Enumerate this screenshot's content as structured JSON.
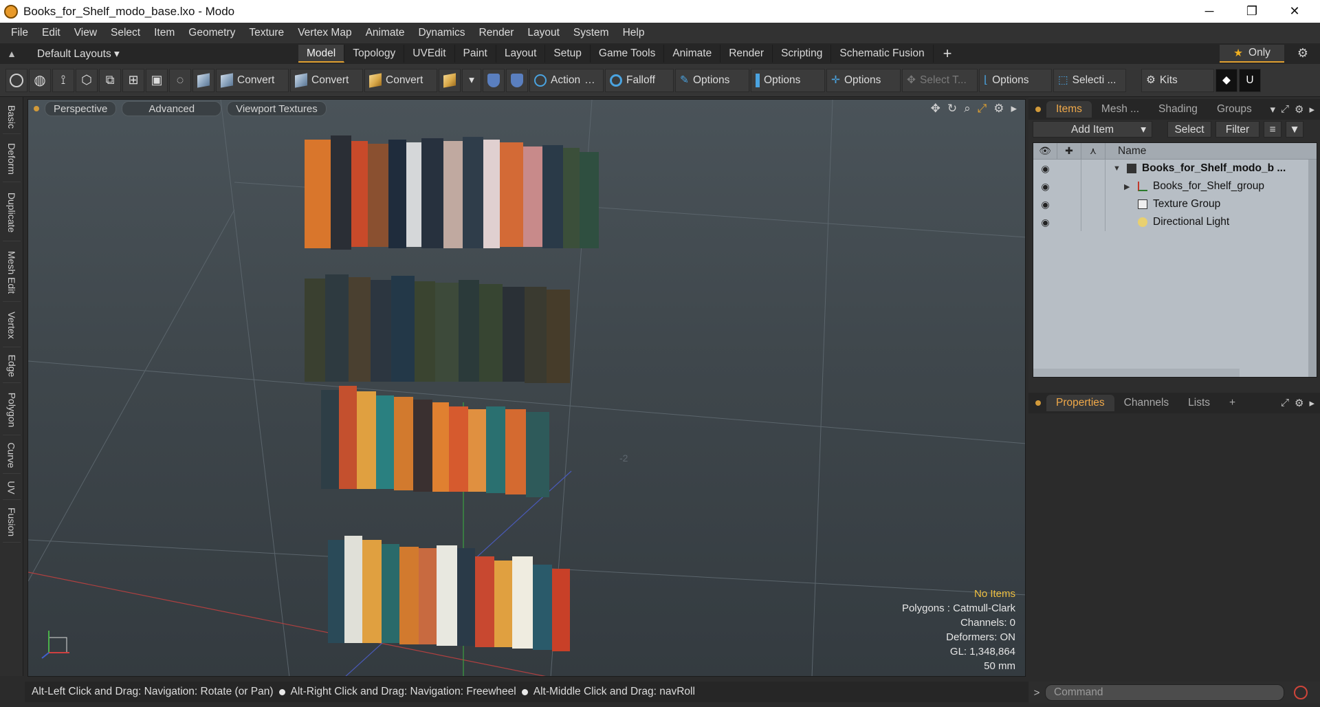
{
  "window": {
    "title": "Books_for_Shelf_modo_base.lxo - Modo",
    "controls": [
      "─",
      "❐",
      "✕"
    ]
  },
  "menubar": [
    "File",
    "Edit",
    "View",
    "Select",
    "Item",
    "Geometry",
    "Texture",
    "Vertex Map",
    "Animate",
    "Dynamics",
    "Render",
    "Layout",
    "System",
    "Help"
  ],
  "layoutbar": {
    "layouts_label": "Default Layouts ▾",
    "tabs": [
      "Model",
      "Topology",
      "UVEdit",
      "Paint",
      "Layout",
      "Setup",
      "Game Tools",
      "Animate",
      "Render",
      "Scripting",
      "Schematic Fusion"
    ],
    "active_tab": "Model",
    "add_label": "+",
    "only_label": "Only",
    "accent_color": "#e0a030"
  },
  "toolbar": {
    "convert1": "Convert",
    "convert2": "Convert",
    "convert3": "Convert",
    "action": "Action",
    "action_more": "…",
    "falloff": "Falloff",
    "options1": "Options",
    "options2": "Options",
    "options3": "Options",
    "select_t": "Select T...",
    "options4": "Options",
    "selecti": "Selecti ...",
    "kits": "Kits"
  },
  "lefttabs": [
    "Basic",
    "Deform",
    "Duplicate",
    "Mesh Edit",
    "Vertex",
    "Edge",
    "Polygon",
    "Curve",
    "UV",
    "Fusion"
  ],
  "viewport": {
    "perspective": "Perspective",
    "advanced": "Advanced",
    "textures": "Viewport Textures",
    "info_selection": "No Items",
    "info_polygons": "Polygons : Catmull-Clark",
    "info_channels": "Channels: 0",
    "info_deformers": "Deformers: ON",
    "info_gl": "GL: 1,348,864",
    "info_scale": "50 mm",
    "grid_label": "-2",
    "highlight_color": "#f0c040"
  },
  "statusbar": {
    "hint1": "Alt-Left Click and Drag: Navigation: Rotate (or Pan)",
    "hint2": "Alt-Right Click and Drag: Navigation: Freewheel",
    "hint3": "Alt-Middle Click and Drag: navRoll"
  },
  "items_panel": {
    "tabs": [
      "Items",
      "Mesh ...",
      "Shading",
      "Groups"
    ],
    "active_tab": "Items",
    "add_item": "Add Item",
    "select": "Select",
    "filter": "Filter",
    "name_header": "Name",
    "rows": [
      {
        "label": "Books_for_Shelf_modo_b ...",
        "bold": true
      },
      {
        "label": "Books_for_Shelf_group",
        "bold": false
      },
      {
        "label": "Texture Group",
        "bold": false
      },
      {
        "label": "Directional Light",
        "bold": false
      }
    ],
    "accent_color": "#f0a94a"
  },
  "properties_panel": {
    "tabs": [
      "Properties",
      "Channels",
      "Lists"
    ],
    "active_tab": "Properties",
    "add": "+"
  },
  "command": {
    "placeholder": "Command",
    "prompt": ">"
  }
}
